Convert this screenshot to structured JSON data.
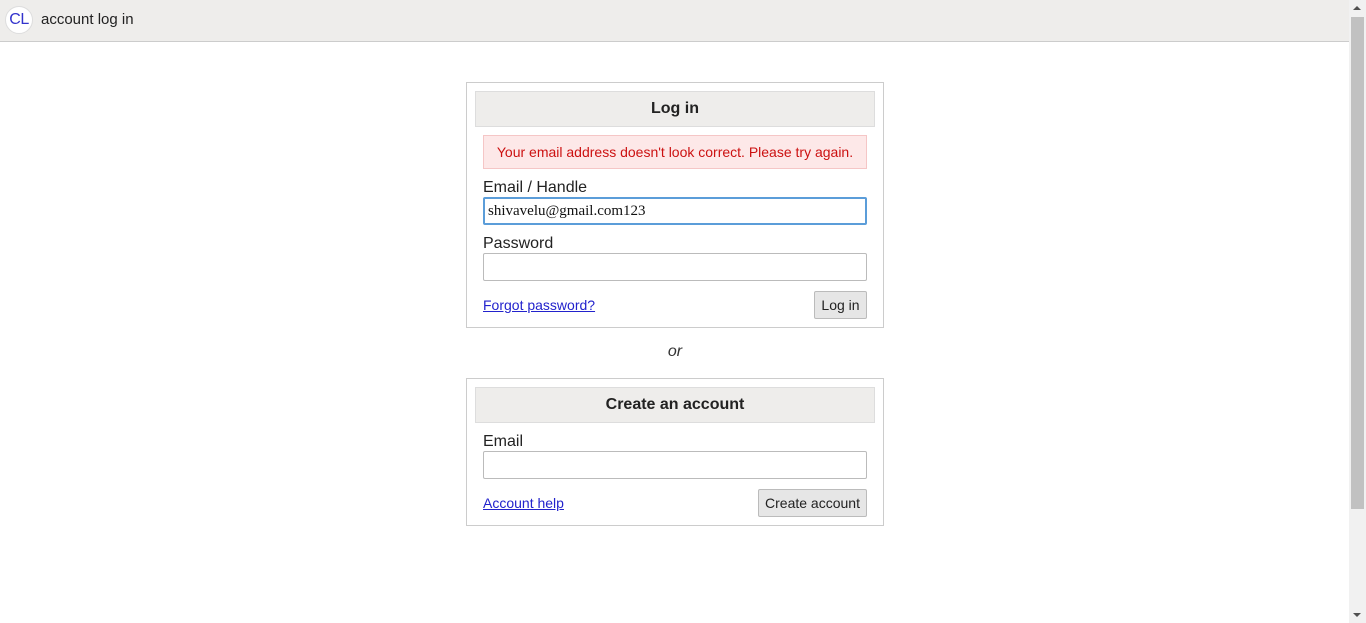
{
  "header": {
    "logo_text": "CL",
    "title": "account log in"
  },
  "login": {
    "title": "Log in",
    "error_message": "Your email address doesn't look correct. Please try again.",
    "email_label": "Email / Handle",
    "email_value": "shivavelu@gmail.com123",
    "password_label": "Password",
    "password_value": "",
    "forgot_link": "Forgot password?",
    "submit_label": "Log in"
  },
  "separator_text": "or",
  "create": {
    "title": "Create an account",
    "email_label": "Email",
    "email_value": "",
    "help_link": "Account help",
    "submit_label": "Create account"
  },
  "colors": {
    "header_bg": "#eeedeb",
    "error_text": "#cc1111",
    "error_bg": "#fde8e8",
    "link": "#2222cc",
    "focus_border": "#5b9dd9"
  }
}
